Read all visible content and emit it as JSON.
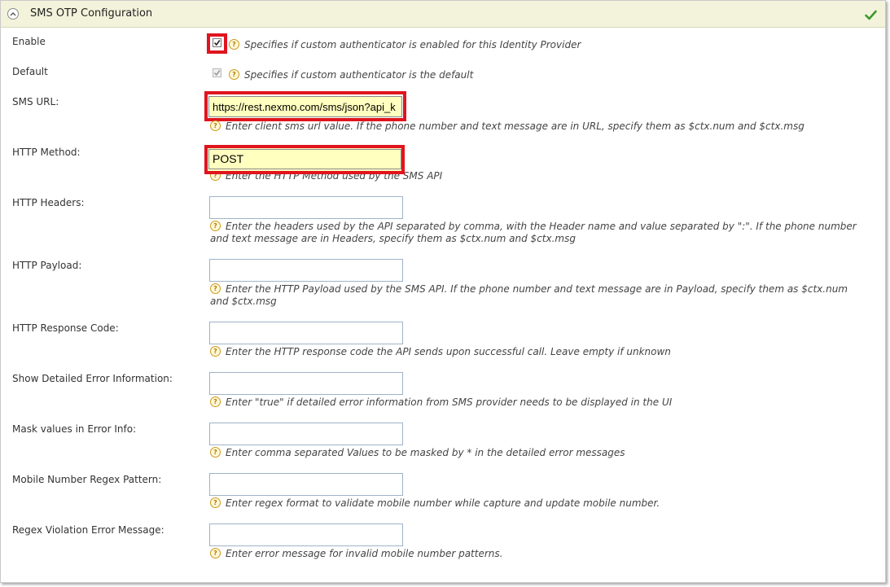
{
  "panel": {
    "title": "SMS OTP Configuration"
  },
  "fields": {
    "enable": {
      "label": "Enable",
      "checked": true,
      "help": "Specifies if custom authenticator is enabled for this Identity Provider"
    },
    "default": {
      "label": "Default",
      "checked": true,
      "disabled": true,
      "help": "Specifies if custom authenticator is the default"
    },
    "sms_url": {
      "label": "SMS URL:",
      "value": "https://rest.nexmo.com/sms/json?api_k",
      "help": "Enter client sms url value. If the phone number and text message are in URL, specify them as $ctx.num and $ctx.msg"
    },
    "http_method": {
      "label": "HTTP Method:",
      "value": "POST",
      "help": "Enter the HTTP Method used by the SMS API"
    },
    "http_headers": {
      "label": "HTTP Headers:",
      "value": "",
      "help": "Enter the headers used by the API separated by comma, with the Header name and value separated by \":\". If the phone number and text message are in Headers, specify them as $ctx.num and $ctx.msg"
    },
    "http_payload": {
      "label": "HTTP Payload:",
      "value": "",
      "help": "Enter the HTTP Payload used by the SMS API. If the phone number and text message are in Payload, specify them as $ctx.num and $ctx.msg"
    },
    "http_response_code": {
      "label": "HTTP Response Code:",
      "value": "",
      "help": "Enter the HTTP response code the API sends upon successful call. Leave empty if unknown"
    },
    "show_detailed_error": {
      "label": "Show Detailed Error Information:",
      "value": "",
      "help": "Enter \"true\" if detailed error information from SMS provider needs to be displayed in the UI"
    },
    "mask_values": {
      "label": "Mask values in Error Info:",
      "value": "",
      "help": "Enter comma separated Values to be masked by * in the detailed error messages"
    },
    "mobile_regex": {
      "label": "Mobile Number Regex Pattern:",
      "value": "",
      "help": "Enter regex format to validate mobile number while capture and update mobile number."
    },
    "regex_violation": {
      "label": "Regex Violation Error Message:",
      "value": "",
      "help": "Enter error message for invalid mobile number patterns."
    }
  },
  "colors": {
    "header_bg": "#f3f3dc",
    "highlight": "#e0141e",
    "input_highlight_bg": "#ffffc0",
    "check_green": "#3a9a2a",
    "help_icon": "#c99a1e"
  },
  "icons": [
    "collapse-icon",
    "check-icon",
    "help-icon",
    "checkbox-check-icon"
  ]
}
